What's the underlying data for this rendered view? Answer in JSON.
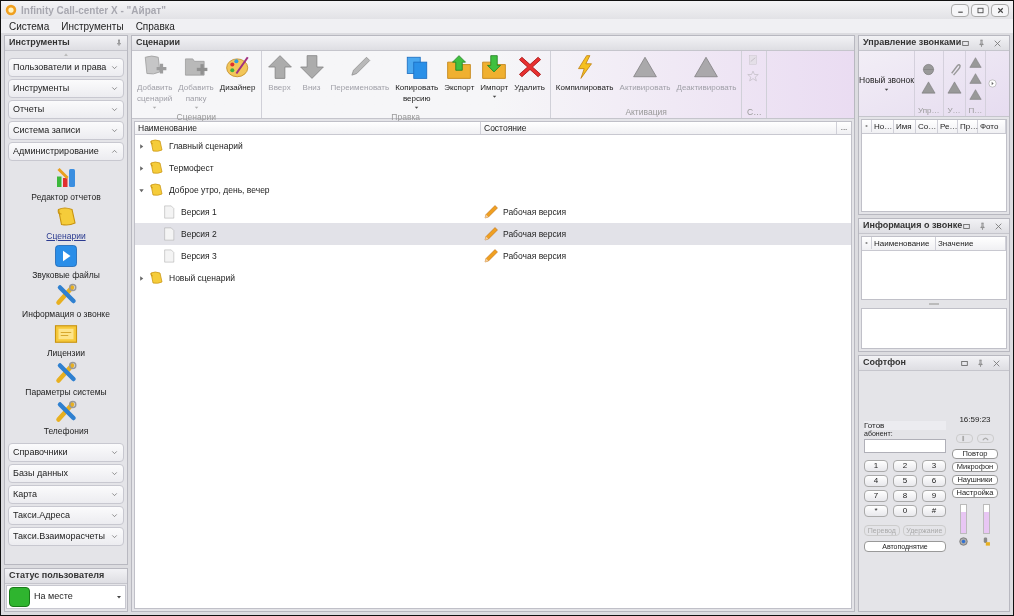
{
  "window": {
    "title": "Infinity Call-center X - \"Айрат\""
  },
  "menu": [
    "Система",
    "Инструменты",
    "Справка"
  ],
  "tools_panel": {
    "title": "Инструменты",
    "groups": [
      {
        "label": "Пользователи и права",
        "expanded": false
      },
      {
        "label": "Инструменты",
        "expanded": false
      },
      {
        "label": "Отчеты",
        "expanded": false
      },
      {
        "label": "Система записи",
        "expanded": false
      },
      {
        "label": "Администрирование",
        "expanded": true,
        "items": [
          {
            "label": "Редактор отчетов",
            "kind": "chart",
            "selected": false
          },
          {
            "label": "Сценарии",
            "kind": "scroll",
            "selected": true
          },
          {
            "label": "Звуковые файлы",
            "kind": "play",
            "selected": false
          },
          {
            "label": "Информация о звонке",
            "kind": "tools",
            "selected": false
          },
          {
            "label": "Лицензии",
            "kind": "certificate",
            "selected": false
          },
          {
            "label": "Параметры системы",
            "kind": "tools",
            "selected": false
          },
          {
            "label": "Телефония",
            "kind": "tools",
            "selected": false
          }
        ]
      },
      {
        "label": "Справочники",
        "expanded": false
      },
      {
        "label": "Базы данных",
        "expanded": false
      },
      {
        "label": "Карта",
        "expanded": false
      },
      {
        "label": "Такси.Адреса",
        "expanded": false
      },
      {
        "label": "Такси.Взаиморасчеты",
        "expanded": false
      }
    ]
  },
  "user_status": {
    "title": "Статус пользователя",
    "value": "На месте",
    "color": "#2fb52f"
  },
  "scenarios": {
    "title": "Сценарии",
    "ribbon": [
      {
        "label": "Сценарии",
        "buttons": [
          {
            "label": "Добавить сценарий",
            "kind": "newscript",
            "disabled": true,
            "dropdown": true
          },
          {
            "label": "Добавить папку",
            "kind": "newfolder",
            "disabled": true,
            "dropdown": true
          },
          {
            "label": "Дизайнер",
            "kind": "palette",
            "disabled": false,
            "dropdown": false
          }
        ]
      },
      {
        "label": "Правка",
        "buttons": [
          {
            "label": "Вверх",
            "kind": "up",
            "disabled": true,
            "dropdown": false
          },
          {
            "label": "Вниз",
            "kind": "down",
            "disabled": true,
            "dropdown": false
          },
          {
            "label": "Переименовать",
            "kind": "pencil",
            "disabled": true,
            "dropdown": false
          },
          {
            "label": "Копировать версию",
            "kind": "copy",
            "disabled": false,
            "dropdown": true
          },
          {
            "label": "Экспорт",
            "kind": "export",
            "disabled": false,
            "dropdown": false
          },
          {
            "label": "Импорт",
            "kind": "import",
            "disabled": false,
            "dropdown": true
          },
          {
            "label": "Удалить",
            "kind": "delete",
            "disabled": false,
            "dropdown": false
          }
        ]
      },
      {
        "label": "Активация",
        "buttons": [
          {
            "label": "Компилировать",
            "kind": "bolt",
            "disabled": false,
            "dropdown": false
          },
          {
            "label": "Активировать",
            "kind": "triangle",
            "disabled": true,
            "dropdown": false
          },
          {
            "label": "Деактивировать",
            "kind": "triangle",
            "disabled": true,
            "dropdown": false
          }
        ]
      },
      {
        "label": "С…",
        "buttons": [
          {
            "kind": "note",
            "disabled": true
          },
          {
            "kind": "star",
            "disabled": true
          }
        ]
      }
    ],
    "columns": [
      "Наименование",
      "Состояние"
    ],
    "more_button": "...",
    "tree": [
      {
        "label": "Главный сценарий",
        "kind": "folder",
        "expanded": false,
        "selected": false
      },
      {
        "label": "Термофест",
        "kind": "folder",
        "expanded": false,
        "selected": false
      },
      {
        "label": "Доброе утро, день, вечер",
        "kind": "folder",
        "expanded": true,
        "selected": false,
        "children": [
          {
            "label": "Версия 1",
            "kind": "version",
            "selected": false,
            "state": "Рабочая версия"
          },
          {
            "label": "Версия 2",
            "kind": "version",
            "selected": true,
            "state": "Рабочая версия"
          },
          {
            "label": "Версия 3",
            "kind": "version",
            "selected": false,
            "state": "Рабочая версия"
          }
        ]
      },
      {
        "label": "Новый сценарий",
        "kind": "folder",
        "expanded": false,
        "selected": false
      }
    ]
  },
  "call_control": {
    "title": "Управление звонками",
    "new_call": "Новый звонок",
    "groups": [
      {
        "label": "Упр…",
        "buttons": [
          {
            "kind": "ball"
          },
          {
            "kind": "triangle"
          }
        ]
      },
      {
        "label": "У…",
        "buttons": [
          {
            "kind": "clip"
          },
          {
            "kind": "triangle"
          }
        ]
      },
      {
        "label": "П…",
        "buttons": [
          {
            "kind": "triangle"
          },
          {
            "kind": "triangle"
          },
          {
            "kind": "triangle"
          }
        ]
      }
    ],
    "columns": [
      "Но…",
      "Имя",
      "Со…",
      "Ре…",
      "Пр…",
      "Фото"
    ]
  },
  "call_info": {
    "title": "Информация о звонке",
    "columns": [
      "Наименование",
      "Значение"
    ]
  },
  "softphone": {
    "title": "Софтфон",
    "status": "Готов",
    "subscriber_label": "абонент:",
    "time": "16:59:23",
    "keys": [
      "1",
      "2",
      "3",
      "4",
      "5",
      "6",
      "7",
      "8",
      "9",
      "*",
      "0",
      "#"
    ],
    "side_buttons": [
      "Повтор",
      "Микрофон",
      "Наушники",
      "Настройка"
    ],
    "actions": [
      {
        "label": "Перевод",
        "disabled": true
      },
      {
        "label": "Удержание",
        "disabled": true
      }
    ],
    "auto_answer": "Автоподнятие",
    "volumes": [
      {
        "kind": "speaker",
        "level": 0.75
      },
      {
        "kind": "microphone",
        "level": 0.75
      }
    ]
  }
}
